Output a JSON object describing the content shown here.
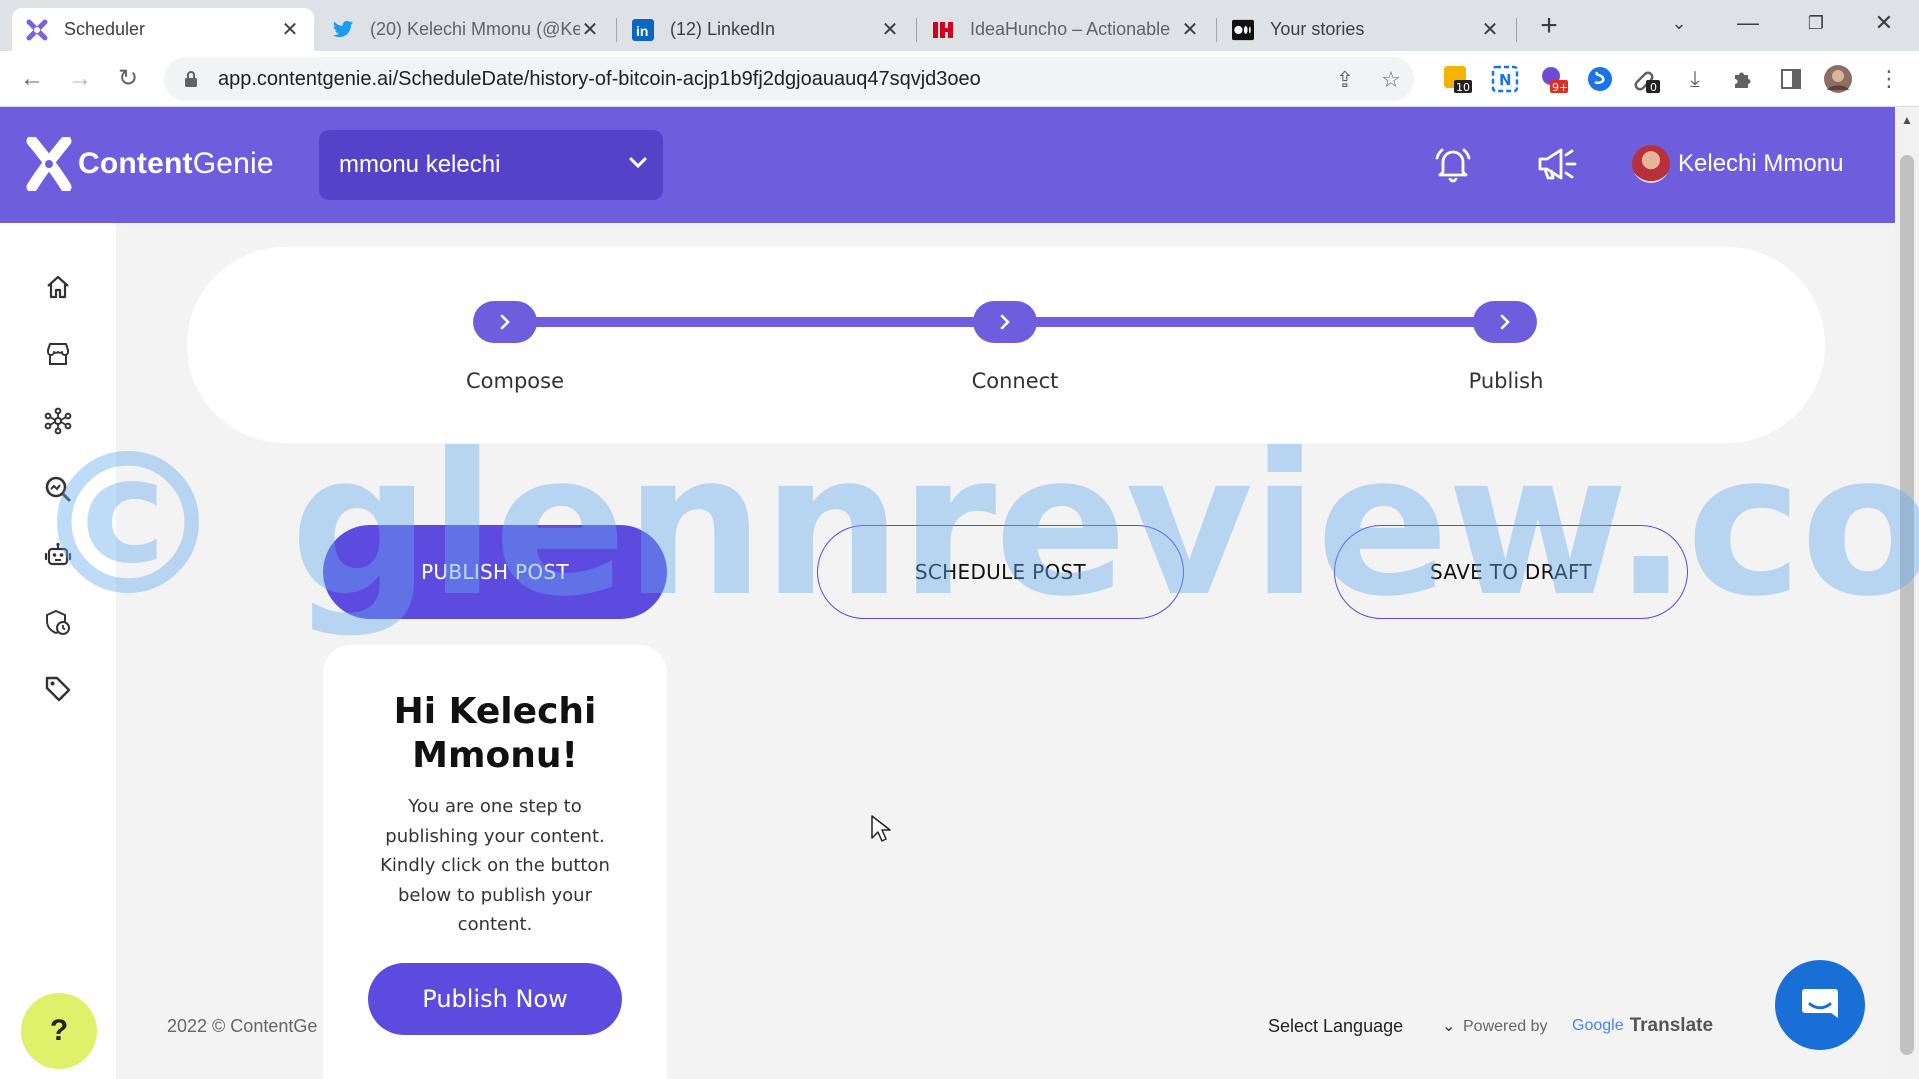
{
  "browser": {
    "tabs": [
      {
        "title": "Scheduler",
        "icon": "contentgenie-favicon",
        "active": true
      },
      {
        "title": "(20) Kelechi Mmonu (@Ke",
        "icon": "twitter-favicon"
      },
      {
        "title": "(12) LinkedIn",
        "icon": "linkedin-favicon"
      },
      {
        "title": "IdeaHuncho – Actionable",
        "icon": "ideahuncho-favicon"
      },
      {
        "title": "Your stories",
        "icon": "medium-favicon"
      }
    ],
    "url": "app.contentgenie.ai/ScheduleDate/history-of-bitcoin-acjp1b9fj2dgjoauauq47sqvjd3oeo",
    "extension_badges": {
      "ext1": "10",
      "ext3": "9+",
      "ext5": "0"
    }
  },
  "app": {
    "logo": {
      "bold": "Content",
      "light": "Genie"
    },
    "workspace": "mmonu kelechi",
    "user_name": "Kelechi Mmonu",
    "accent": "#6e5ede",
    "button_color": "#5d4be0"
  },
  "stepper": {
    "steps": [
      "Compose",
      "Connect",
      "Publish"
    ]
  },
  "actions": {
    "publish": "PUBLISH POST",
    "schedule": "SCHEDULE POST",
    "draft": "SAVE TO DRAFT"
  },
  "hi_card": {
    "title": "Hi Kelechi Mmonu!",
    "text": "You are one step to publishing your content. Kindly click on the button below to publish your content.",
    "button": "Publish Now"
  },
  "footer": {
    "copyright": "2022 © ContentGe",
    "select_language": "Select Language",
    "powered_by": "Powered by",
    "google": "Google",
    "translate": "Translate"
  },
  "help": "?",
  "watermark": "© glennreview.com"
}
